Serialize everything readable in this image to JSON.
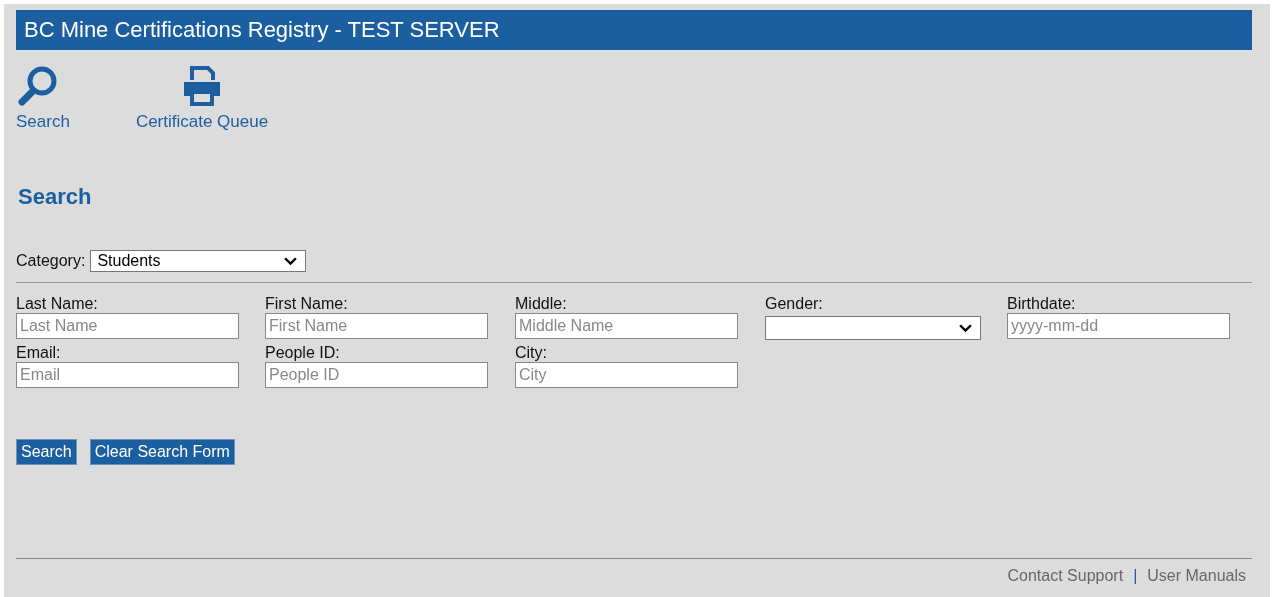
{
  "window": {
    "title": "BC Mine Certifications Registry - TEST SERVER"
  },
  "nav": [
    {
      "label": "Search",
      "kind": "search"
    },
    {
      "label": "Certificate Queue",
      "kind": "print"
    }
  ],
  "heading": "Search",
  "category": {
    "label": "Category:",
    "value": "Students"
  },
  "form_rows": [
    [
      {
        "label": "Last Name:",
        "kind": "text",
        "placeholder": "Last Name"
      },
      {
        "label": "First Name:",
        "kind": "text",
        "placeholder": "First Name"
      },
      {
        "label": "Middle:",
        "kind": "text",
        "placeholder": "Middle Name"
      },
      {
        "label": "Gender:",
        "kind": "select"
      },
      {
        "label": "Birthdate:",
        "kind": "text",
        "placeholder": "yyyy-mm-dd"
      }
    ],
    [
      {
        "label": "Email:",
        "kind": "text",
        "placeholder": "Email"
      },
      {
        "label": "People ID:",
        "kind": "text",
        "placeholder": "People ID"
      },
      {
        "label": "City:",
        "kind": "text",
        "placeholder": "City"
      }
    ]
  ],
  "buttons": [
    "Search",
    "Clear Search Form"
  ],
  "footer": {
    "links": [
      "Contact Support",
      "User Manuals"
    ],
    "separator": "|"
  }
}
